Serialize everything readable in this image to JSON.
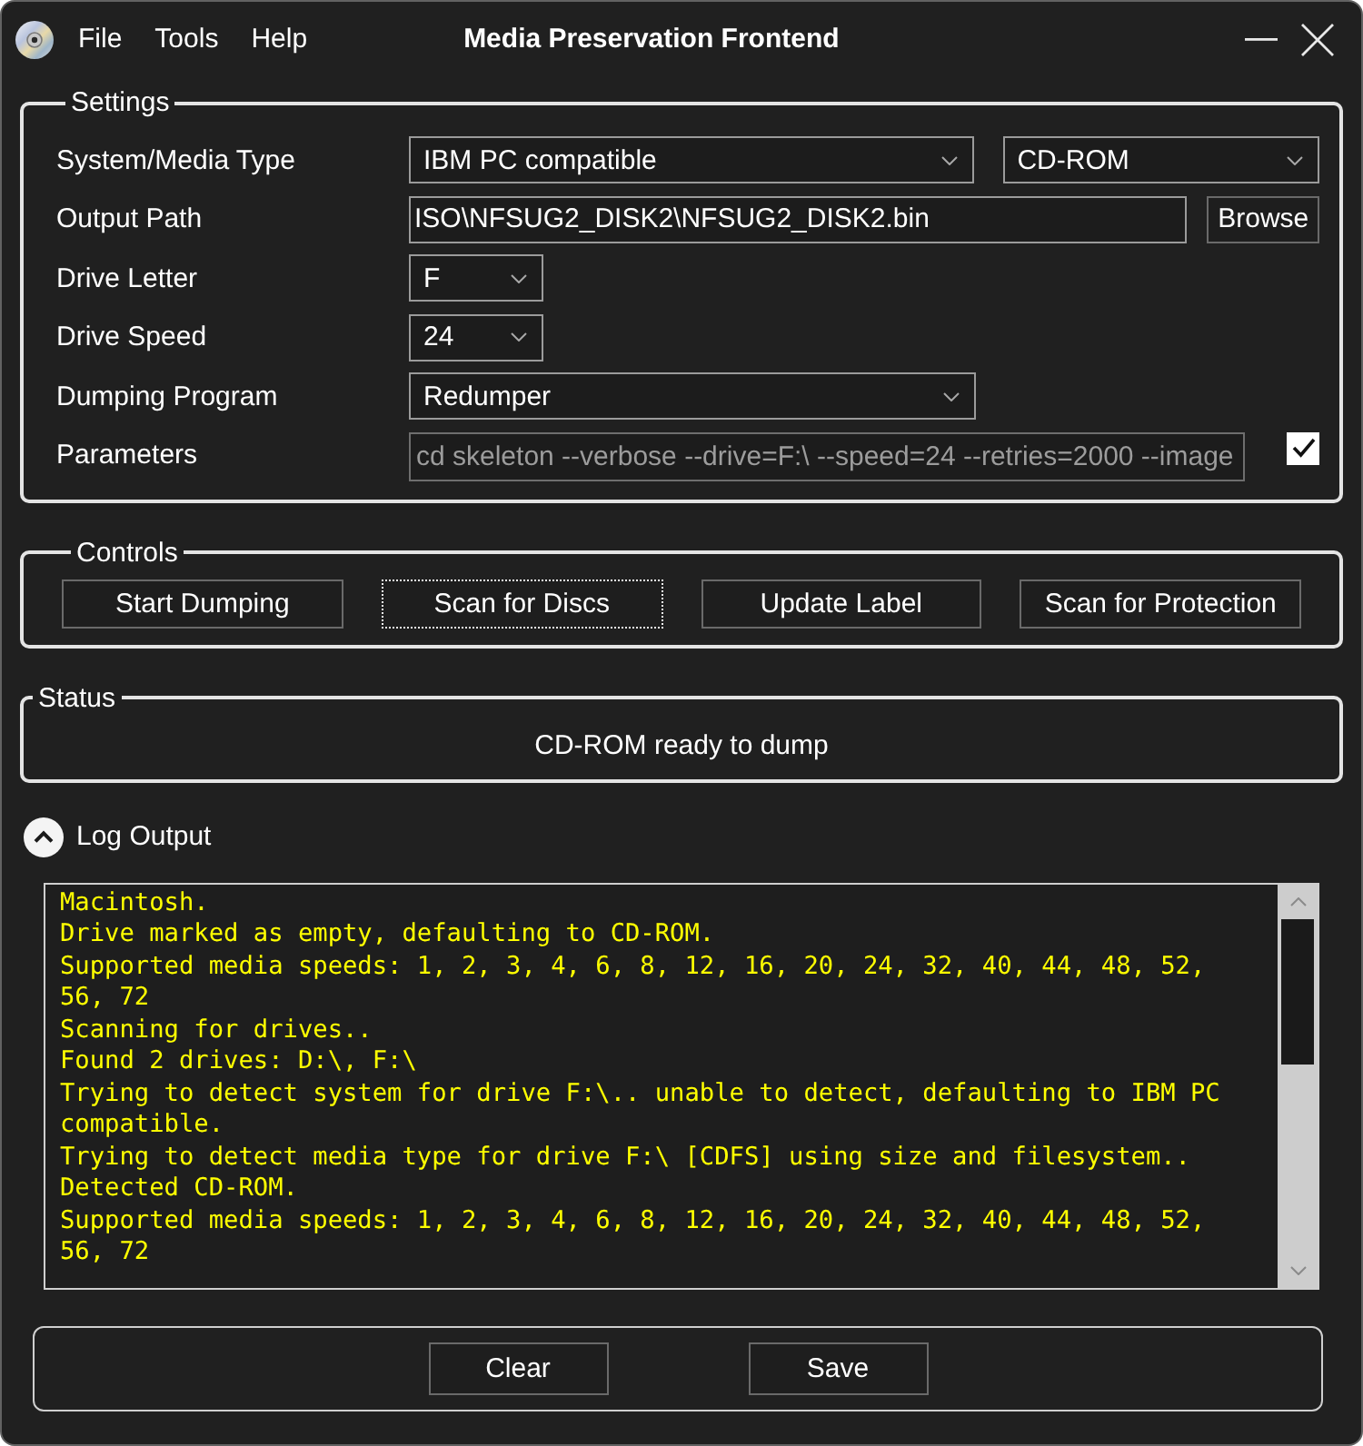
{
  "window": {
    "title": "Media Preservation Frontend"
  },
  "menu": [
    "File",
    "Tools",
    "Help"
  ],
  "settings": {
    "title": "Settings",
    "rows": [
      {
        "label": "System/Media Type",
        "controls": [
          {
            "kind": "combo",
            "value": "IBM PC compatible",
            "disabled": false
          },
          {
            "kind": "combo",
            "value": "CD-ROM",
            "disabled": false
          }
        ]
      },
      {
        "label": "Output Path",
        "controls": [
          {
            "kind": "field",
            "value": "ISO\\NFSUG2_DISK2\\NFSUG2_DISK2.bin",
            "disabled": false
          },
          {
            "kind": "button",
            "label": "Browse"
          }
        ]
      },
      {
        "label": "Drive Letter",
        "controls": [
          {
            "kind": "combo",
            "value": "F",
            "disabled": false
          }
        ]
      },
      {
        "label": "Drive Speed",
        "controls": [
          {
            "kind": "combo",
            "value": "24",
            "disabled": false
          }
        ]
      },
      {
        "label": "Dumping Program",
        "controls": [
          {
            "kind": "combo",
            "value": "Redumper",
            "disabled": false
          }
        ]
      },
      {
        "label": "Parameters",
        "controls": [
          {
            "kind": "field",
            "value": "cd skeleton --verbose --drive=F:\\ --speed=24 --retries=2000 --image",
            "disabled": true
          },
          {
            "kind": "checkbox",
            "checked": true
          }
        ]
      }
    ]
  },
  "controls": {
    "title": "Controls",
    "buttons": [
      {
        "label": "Start Dumping",
        "focused": false
      },
      {
        "label": "Scan for Discs",
        "focused": true
      },
      {
        "label": "Update Label",
        "focused": false
      },
      {
        "label": "Scan for Protection",
        "focused": false
      }
    ]
  },
  "status": {
    "title": "Status",
    "text": "CD-ROM ready to dump"
  },
  "log": {
    "title": "Log Output",
    "expanded": true,
    "lines": [
      "Macintosh.",
      "Drive marked as empty, defaulting to CD-ROM.",
      "Supported media speeds: 1, 2, 3, 4, 6, 8, 12, 16, 20, 24, 32, 40, 44, 48, 52, 56, 72",
      "Scanning for drives..",
      "Found 2 drives: D:\\, F:\\",
      "Trying to detect system for drive F:\\.. unable to detect, defaulting to IBM PC compatible.",
      "Trying to detect media type for drive F:\\ [CDFS] using size and filesystem..",
      "Detected CD-ROM.",
      "Supported media speeds: 1, 2, 3, 4, 6, 8, 12, 16, 20, 24, 32, 40, 44, 48, 52, 56, 72"
    ]
  },
  "log_buttons": [
    "Clear",
    "Save"
  ]
}
